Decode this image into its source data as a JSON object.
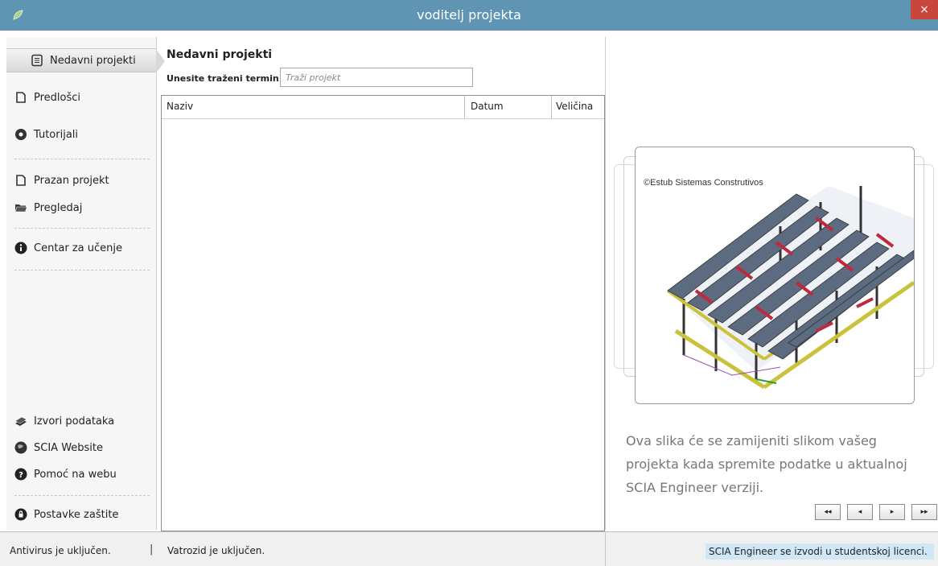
{
  "window": {
    "title": "voditelj projekta",
    "close_label": "×"
  },
  "sidebar": {
    "recent": "Nedavni projekti",
    "templates": "Predlošci",
    "tutorials": "Tutorijali",
    "empty_project": "Prazan projekt",
    "browse": "Pregledaj",
    "learning_center": "Centar za učenje",
    "data_sources": "Izvori podataka",
    "scia_website": "SCIA Website",
    "web_help": "Pomoć na webu",
    "protection_settings": "Postavke zaštite"
  },
  "main": {
    "title": "Nedavni projekti",
    "search_label": "Unesite traženi termin:",
    "search_placeholder": "Traži projekt",
    "columns": [
      "Naziv",
      "Datum",
      "Veličina"
    ]
  },
  "preview": {
    "credit": "©Estub Sistemas Construtivos",
    "caption": "Ova slika će se zamijeniti slikom vašeg projekta kada spremite podatke u aktualnoj SCIA Engineer verziji.",
    "nav": [
      "◂◂",
      "◂",
      "▸",
      "▸▸"
    ]
  },
  "status": {
    "antivirus": "Antivirus je uključen.",
    "separator": "|",
    "firewall": "Vatrozid je uključen.",
    "license": "SCIA Engineer se izvodi u studentskoj licenci."
  },
  "colors": {
    "titlebar": "#5f94b3",
    "close": "#c9463d",
    "license_highlight": "#cfe7f6"
  }
}
